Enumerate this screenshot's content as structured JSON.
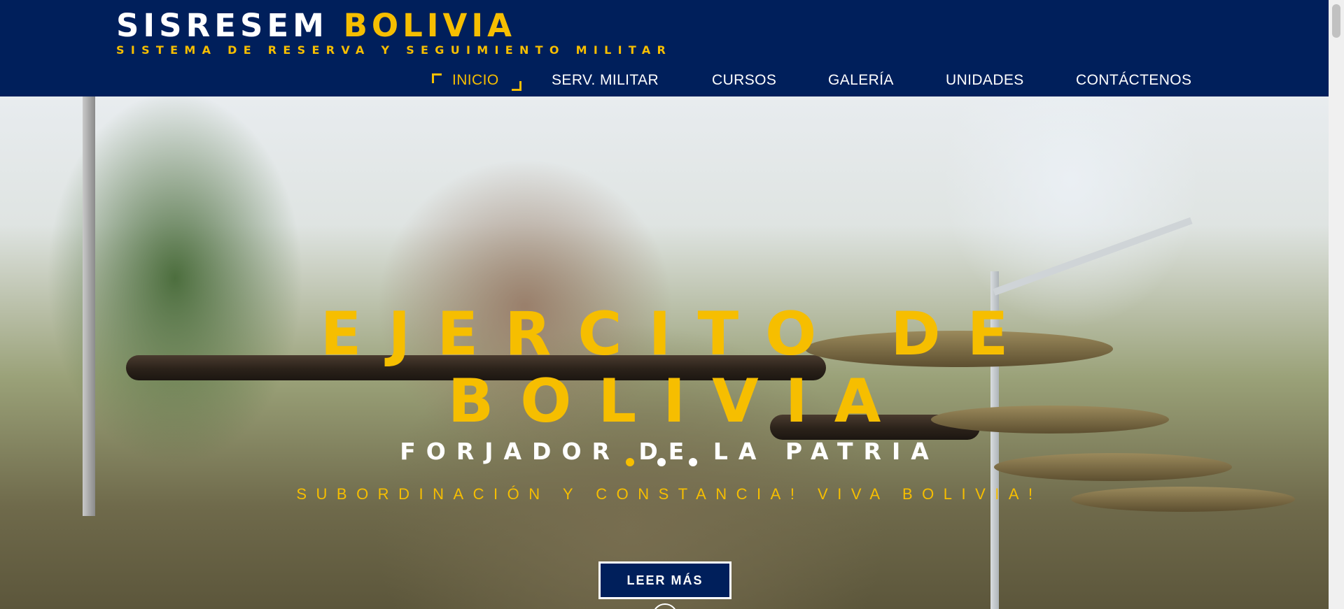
{
  "header": {
    "brand_part1": "SISRESEM",
    "brand_part2": "BOLIVIA",
    "subtitle": "SISTEMA DE RESERVA Y SEGUIMIENTO MILITAR"
  },
  "nav": {
    "items": [
      {
        "label": "INICIO",
        "active": true
      },
      {
        "label": "SERV. MILITAR",
        "active": false
      },
      {
        "label": "CURSOS",
        "active": false
      },
      {
        "label": "GALERÍA",
        "active": false
      },
      {
        "label": "UNIDADES",
        "active": false
      },
      {
        "label": "CONTÁCTENOS",
        "active": false
      }
    ]
  },
  "hero": {
    "title_line1": "EJERCITO DE",
    "title_line2": "BOLIVIA",
    "subtitle": "FORJADOR DE LA PATRIA",
    "motto": "SUBORDINACIÓN Y CONSTANCIA! VIVA BOLIVIA!",
    "button_label": "LEER MÁS",
    "slide_dots": 3,
    "active_slide": 1
  },
  "colors": {
    "navy": "#001f5b",
    "gold": "#f6be00",
    "white": "#ffffff"
  },
  "icons": {
    "active_marker": "corner-bracket-icon",
    "scroll_down": "scroll-down-icon"
  }
}
